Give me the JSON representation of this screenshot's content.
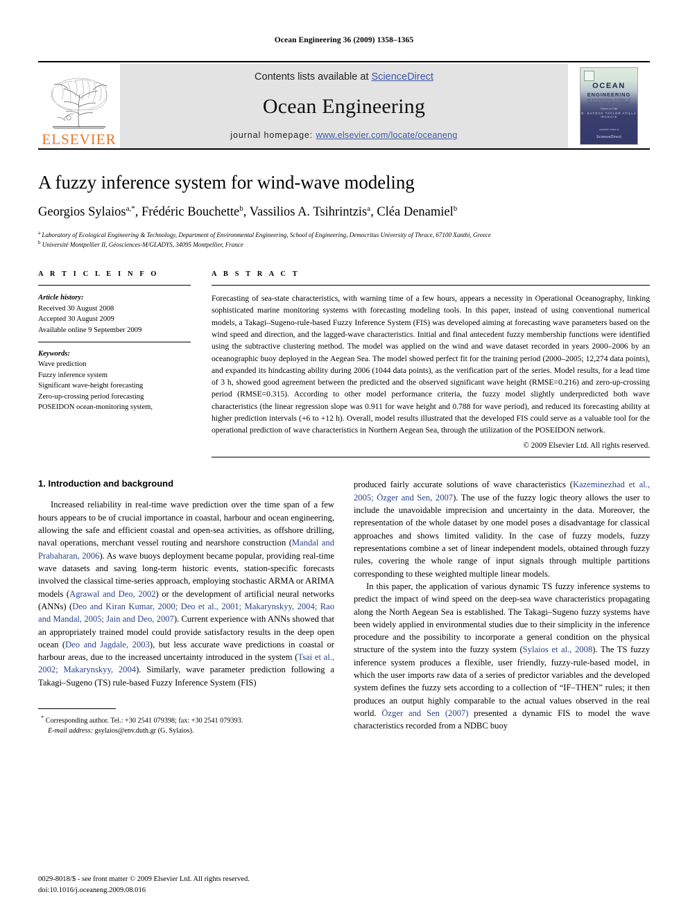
{
  "running_head": "Ocean Engineering 36 (2009) 1358–1365",
  "banner": {
    "contents_prefix": "Contents lists available at ",
    "contents_link": "ScienceDirect",
    "journal_name": "Ocean Engineering",
    "homepage_prefix": "journal homepage: ",
    "homepage_url": "www.elsevier.com/locate/oceaneng",
    "publisher_logo_text": "ELSEVIER",
    "publisher_logo_icon": "elsevier-tree-logo",
    "cover": {
      "title": "OCEAN",
      "subtitle": "ENGINEERING",
      "tagline": "AN INTERNATIONAL JOURNAL OF RESEARCH AND DEVELOPMENT",
      "editors_label": "Editors-in-Chief",
      "editors": "R. EATOCK TAYLOR     ATILLA INCECIK",
      "footer_label": "available online at",
      "footer": "ScienceDirect"
    }
  },
  "article": {
    "title": "A fuzzy inference system for wind-wave modeling",
    "authors": [
      {
        "name": "Georgios Sylaios",
        "marks": "a,*"
      },
      {
        "name": "Frédéric Bouchette",
        "marks": "b"
      },
      {
        "name": "Vassilios A. Tsihrintzis",
        "marks": "a"
      },
      {
        "name": "Cléa Denamiel",
        "marks": "b"
      }
    ],
    "affiliations": [
      {
        "mark": "a",
        "text": "Laboratory of Ecological Engineering & Technology, Department of Environmental Engineering, School of Engineering, Democritus University of Thrace, 67100 Xanthi, Greece"
      },
      {
        "mark": "b",
        "text": "Université Montpellier II, Géosciences-M/GLADYS, 34095 Montpellier, France"
      }
    ]
  },
  "article_info": {
    "heading": "A R T I C L E   I N F O",
    "history_label": "Article history:",
    "history": [
      "Received 30 August 2008",
      "Accepted 30 August 2009",
      "Available online 9 September 2009"
    ],
    "keywords_label": "Keywords:",
    "keywords": [
      "Wave prediction",
      "Fuzzy inference system",
      "Significant wave-height forecasting",
      "Zero-up-crossing period forecasting",
      "POSEIDON ocean-monitoring system,"
    ]
  },
  "abstract": {
    "heading": "A B S T R A C T",
    "text": "Forecasting of sea-state characteristics, with warning time of a few hours, appears a necessity in Operational Oceanography, linking sophisticated marine monitoring systems with forecasting modeling tools. In this paper, instead of using conventional numerical models, a Takagi–Sugeno-rule-based Fuzzy Inference System (FIS) was developed aiming at forecasting wave parameters based on the wind speed and direction, and the lagged-wave characteristics. Initial and final antecedent fuzzy membership functions were identified using the subtractive clustering method. The model was applied on the wind and wave dataset recorded in years 2000–2006 by an oceanographic buoy deployed in the Aegean Sea. The model showed perfect fit for the training period (2000–2005; 12,274 data points), and expanded its hindcasting ability during 2006 (1044 data points), as the verification part of the series. Model results, for a lead time of 3 h, showed good agreement between the predicted and the observed significant wave height (RMSE=0.216) and zero-up-crossing period (RMSE=0.315). According to other model performance criteria, the fuzzy model slightly underpredicted both wave characteristics (the linear regression slope was 0.911 for wave height and 0.788 for wave period), and reduced its forecasting ability at higher prediction intervals (+6 to +12 h). Overall, model results illustrated that the developed FIS could serve as a valuable tool for the operational prediction of wave characteristics in Northern Aegean Sea, through the utilization of the POSEIDON network.",
    "copyright": "© 2009 Elsevier Ltd. All rights reserved."
  },
  "body": {
    "section_number": "1.",
    "section_title": "Introduction and background",
    "left_paragraph_1": {
      "part1": "Increased reliability in real-time wave prediction over the time span of a few hours appears to be of crucial importance in coastal, harbour and ocean engineering, allowing the safe and efficient coastal and open-sea activities, as offshore drilling, naval operations, merchant vessel routing and nearshore construction (",
      "cite1": "Mandal and Prabaharan, 2006",
      "part2": "). As wave buoys deployment became popular, providing real-time wave datasets and saving long-term historic events, station-specific forecasts involved the classical time-series approach, employing stochastic ARMA or ARIMA models (",
      "cite2": "Agrawal and Deo, 2002",
      "part3": ") or the development of artificial neural networks (ANNs) (",
      "cite3": "Deo and Kiran Kumar, 2000; Deo et al., 2001; Makarynskyy, 2004; Rao and Mandal, 2005; Jain and Deo, 2007",
      "part4": "). Current experience with ANNs showed that an appropriately trained model could provide satisfactory results in the deep open ocean (",
      "cite4": "Deo and Jagdale, 2003",
      "part5": "), but less accurate wave predictions in coastal or harbour areas, due to the increased uncertainty introduced in the system (",
      "cite5": "Tsai et al., 2002; Makarynskyy, 2004",
      "part6": "). Similarly, wave parameter prediction following a Takagi–Sugeno (TS) rule-based Fuzzy Inference System (FIS)"
    },
    "right_paragraph_1": {
      "part1": "produced fairly accurate solutions of wave characteristics (",
      "cite1": "Kazeminezhad et al., 2005; Özger and Sen, 2007",
      "part2": "). The use of the fuzzy logic theory allows the user to include the unavoidable imprecision and uncertainty in the data. Moreover, the representation of the whole dataset by one model poses a disadvantage for classical approaches and shows limited validity. In the case of fuzzy models, fuzzy representations combine a set of linear independent models, obtained through fuzzy rules, covering the whole range of input signals through multiple partitions corresponding to these weighted multiple linear models."
    },
    "right_paragraph_2": {
      "part1": "In this paper, the application of various dynamic TS fuzzy inference systems to predict the impact of wind speed on the deep-sea wave characteristics propagating along the North Aegean Sea is established. The Takagi–Sugeno fuzzy systems have been widely applied in environmental studies due to their simplicity in the inference procedure and the possibility to incorporate a general condition on the physical structure of the system into the fuzzy system (",
      "cite1": "Sylaios et al., 2008",
      "part2": "). The TS fuzzy inference system produces a flexible, user friendly, fuzzy-rule-based model, in which the user imports raw data of a series of predictor variables and the developed system defines the fuzzy sets according to a collection of “IF–THEN” rules; it then produces an output highly comparable to the actual values observed in the real world. ",
      "cite2": "Özger and Sen (2007)",
      "part3": " presented a dynamic FIS to model the wave characteristics recorded from a NDBC buoy"
    }
  },
  "footnote": {
    "marker": "*",
    "line1": "Corresponding author. Tel.: +30 2541 079398; fax: +30 2541 079393.",
    "email_label": "E-mail address:",
    "email": "gsylaios@env.duth.gr (G. Sylaios)."
  },
  "page_footer": {
    "line1": "0029-8018/$ - see front matter © 2009 Elsevier Ltd. All rights reserved.",
    "line2": "doi:10.1016/j.oceaneng.2009.08.016"
  },
  "colors": {
    "link": "#3a55a5",
    "citation": "#29418c",
    "elsevier_orange": "#E87722",
    "banner_bg": "#e3e3e3"
  }
}
